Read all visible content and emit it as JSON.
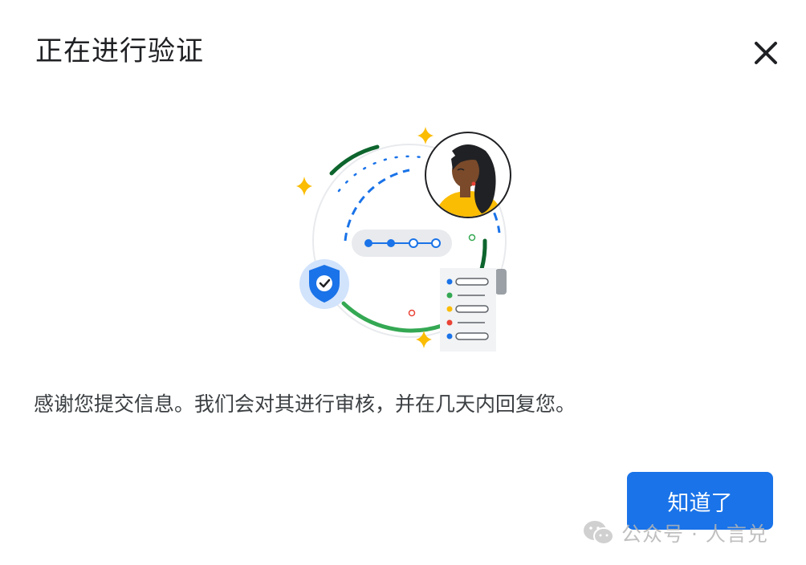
{
  "dialog": {
    "title": "正在进行验证",
    "message": "感谢您提交信息。我们会对其进行审核，并在几天内回复您。",
    "ack_label": "知道了",
    "close_icon": "close-icon"
  },
  "illustration": {
    "icons": [
      "shield-check-icon",
      "avatar-icon",
      "document-list-icon",
      "sparkle-icon",
      "progress-steps-icon"
    ],
    "colors": {
      "blue": "#1a73e8",
      "green": "#34a853",
      "dark_green": "#0d652d",
      "yellow": "#fbbc04",
      "red": "#ea4335",
      "shield_bg": "#d2e3fc"
    }
  },
  "watermark": {
    "icon": "wechat-icon",
    "text": "公众号 · 人言兑"
  }
}
